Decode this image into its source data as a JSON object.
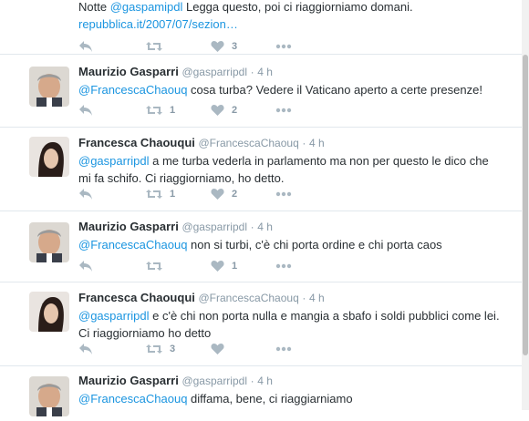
{
  "tweets": [
    {
      "fullname": "",
      "username": "",
      "time": "",
      "text_before_first": "Notte ",
      "mention": "@gaspamipdl",
      "text_after": " Legga questo, poi ci riaggiorniamo domani.",
      "link": "repubblica.it/2007/07/sezion…",
      "retweets": "",
      "likes": "3",
      "avatar": "chaouqui"
    },
    {
      "fullname": "Maurizio Gasparri",
      "username": "@gasparripdl",
      "time": "4 h",
      "mention": "@FrancescaChaouq",
      "text": " cosa turba? Vedere il Vaticano aperto a certe presenze!",
      "retweets": "1",
      "likes": "2",
      "avatar": "gasparri"
    },
    {
      "fullname": "Francesca Chaouqui",
      "username": "@FrancescaChaouq",
      "time": "4 h",
      "mention": "@gasparripdl",
      "text": " a me turba vederla in parlamento ma non per questo le dico che",
      "text2": "mi fa schifo. Ci riaggiorniamo, ho detto.",
      "retweets": "1",
      "likes": "2",
      "avatar": "chaouqui"
    },
    {
      "fullname": "Maurizio Gasparri",
      "username": "@gasparripdl",
      "time": "4 h",
      "mention": "@FrancescaChaouq",
      "text": " non si turbi, c'è chi porta ordine e chi porta caos",
      "retweets": "",
      "likes": "1",
      "avatar": "gasparri"
    },
    {
      "fullname": "Francesca Chaouqui",
      "username": "@FrancescaChaouq",
      "time": "4 h",
      "mention": "@gasparripdl",
      "text": " e c'è chi non porta nulla e mangia a sbafo i soldi pubblici come lei.",
      "text2": "Ci riaggiorniamo ho detto",
      "retweets": "3",
      "likes": "",
      "avatar": "chaouqui"
    },
    {
      "fullname": "Maurizio Gasparri",
      "username": "@gasparripdl",
      "time": "4 h",
      "mention": "@FrancescaChaouq",
      "text": " diffama, bene, ci riaggiarniamo",
      "retweets": "",
      "likes": "",
      "avatar": "gasparri"
    }
  ],
  "separator": "·",
  "icons": {
    "reply": "reply-icon",
    "retweet": "retweet-icon",
    "like": "heart-icon",
    "more": "more-icon"
  },
  "colors": {
    "link": "#1b95e0",
    "muted": "#8899a6",
    "icon": "#aab8c2",
    "border": "#e1e8ed"
  }
}
